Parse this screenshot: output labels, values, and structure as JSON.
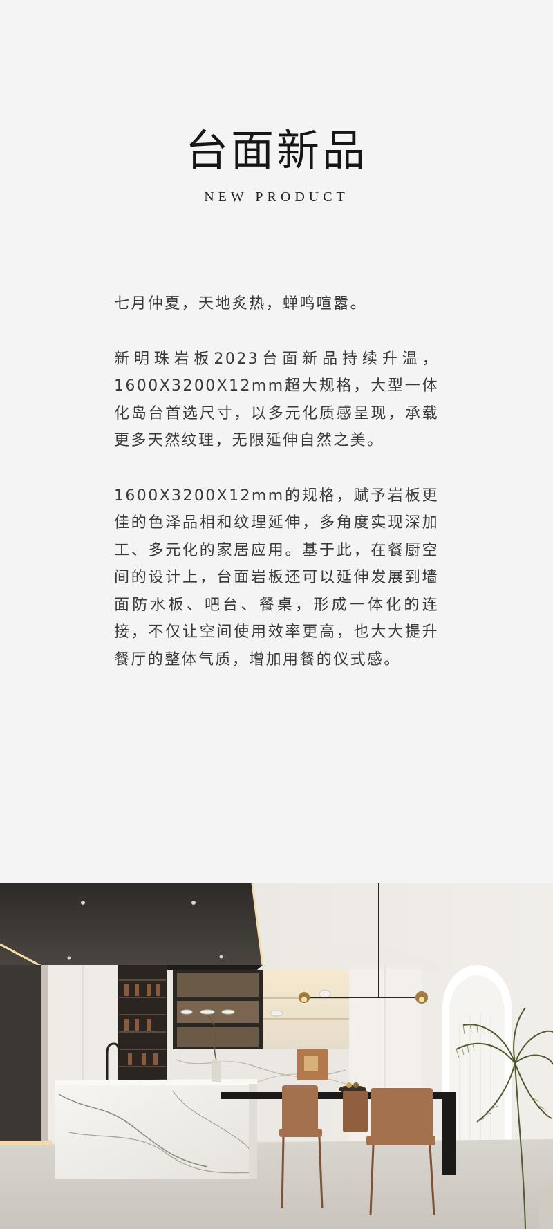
{
  "header": {
    "title": "台面新品",
    "subtitle": "NEW PRODUCT"
  },
  "paragraphs": [
    "七月仲夏，天地炙热，蝉鸣喧嚣。",
    "新明珠岩板2023台面新品持续升温，1600X3200X12mm超大规格，大型一体化岛台首选尺寸，以多元化质感呈现，承载更多天然纹理，无限延伸自然之美。",
    "1600X3200X12mm的规格，赋予岩板更佳的色泽品相和纹理延伸，多角度实现深加工、多元化的家居应用。基于此，在餐厨空间的设计上，台面岩板还可以延伸发展到墙面防水板、吧台、餐桌，形成一体化的连接，不仅让空间使用效率更高，也大大提升餐厅的整体气质，增加用餐的仪式感。"
  ],
  "colors": {
    "background": "#f4f4f4",
    "title": "#161616",
    "text": "#3a3a3a"
  }
}
